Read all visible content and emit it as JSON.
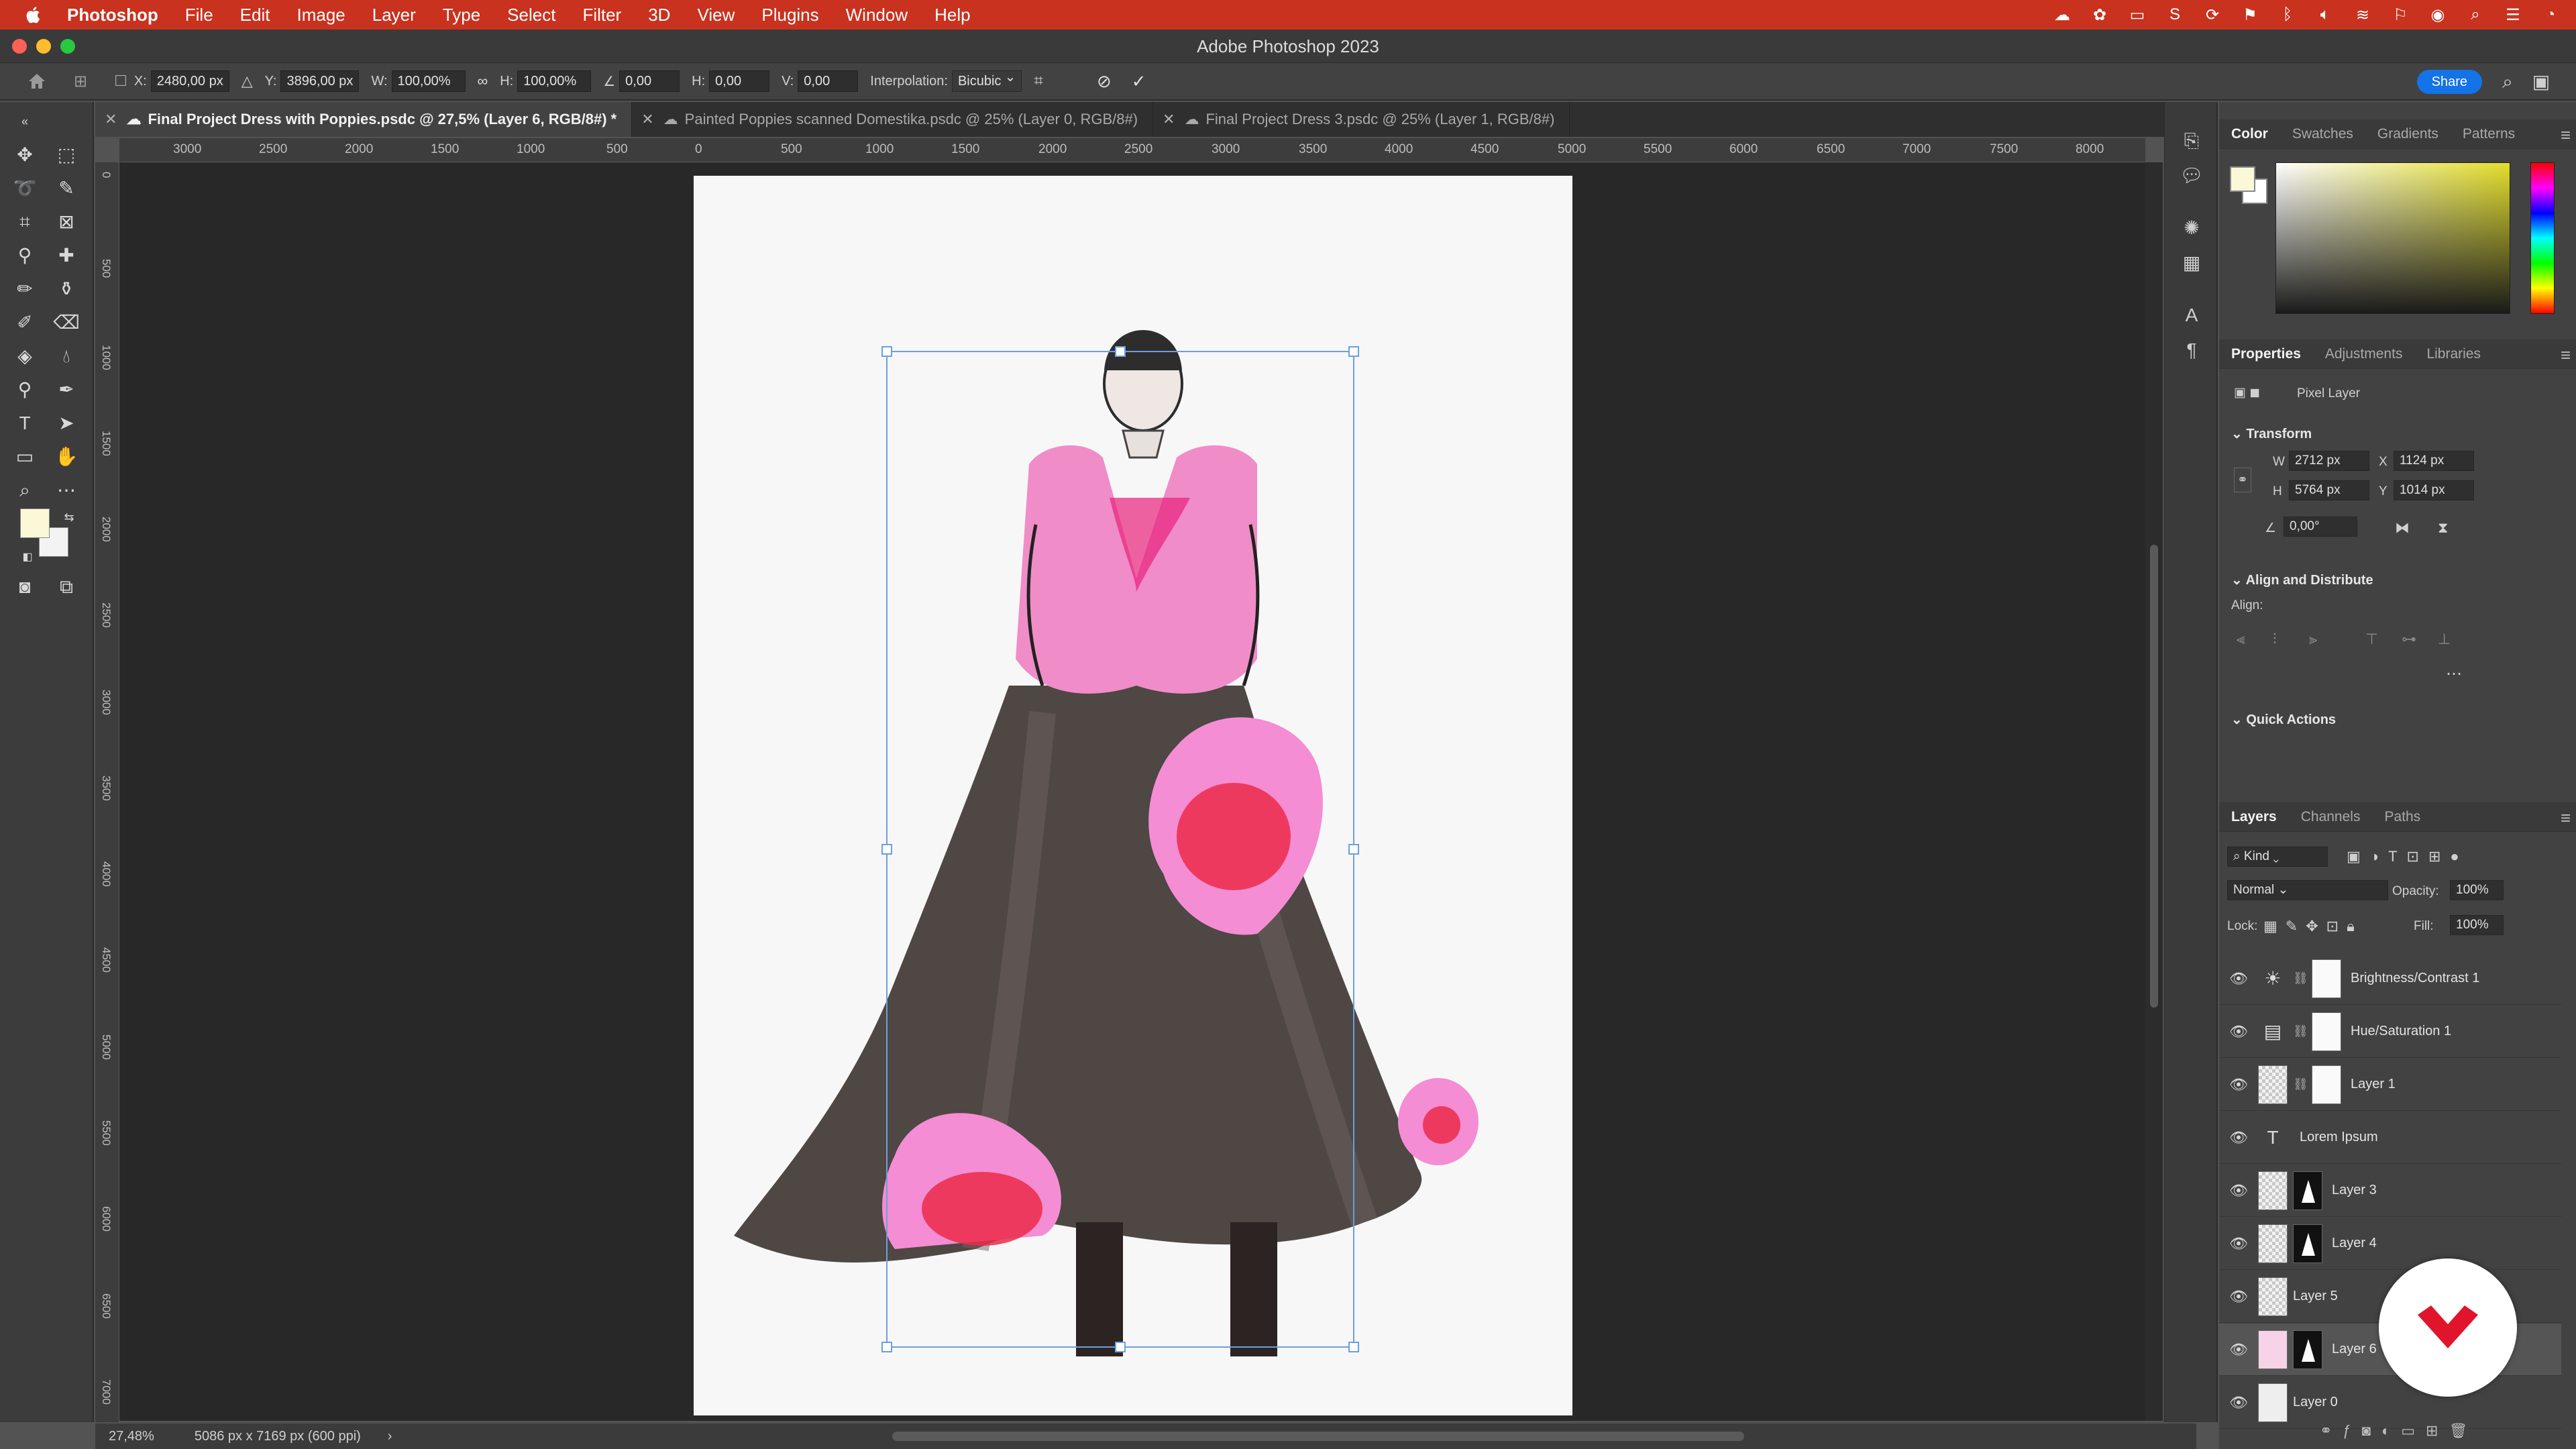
{
  "menubar": {
    "app": "Photoshop",
    "items": [
      "File",
      "Edit",
      "Image",
      "Layer",
      "Type",
      "Select",
      "Filter",
      "3D",
      "View",
      "Plugins",
      "Window",
      "Help"
    ]
  },
  "window": {
    "title": "Adobe Photoshop 2023"
  },
  "options": {
    "x_label": "X:",
    "x": "2480,00 px",
    "y_label": "Y:",
    "y": "3896,00 px",
    "w_label": "W:",
    "w": "100,00%",
    "h_label": "H:",
    "h": "100,00%",
    "angle": "0,00",
    "hskew_label": "H:",
    "hskew": "0,00",
    "vskew_label": "V:",
    "vskew": "0,00",
    "interp_label": "Interpolation:",
    "interp": "Bicubic",
    "share": "Share"
  },
  "tabs": [
    {
      "label": "Final Project Dress with Poppies.psdc @ 27,5% (Layer 6, RGB/8#) *",
      "active": true
    },
    {
      "label": "Painted Poppies scanned Domestika.psdc @ 25% (Layer 0, RGB/8#)",
      "active": false
    },
    {
      "label": "Final Project Dress 3.psdc @ 25% (Layer 1, RGB/8#)",
      "active": false
    }
  ],
  "ruler_h": [
    "3000",
    "2500",
    "2000",
    "1500",
    "1000",
    "500",
    "0",
    "500",
    "1000",
    "1500",
    "2000",
    "2500",
    "3000",
    "3500",
    "4000",
    "4500",
    "5000",
    "5500",
    "6000",
    "6500",
    "7000",
    "7500",
    "8000"
  ],
  "ruler_v": [
    "0",
    "500",
    "1000",
    "1500",
    "2000",
    "2500",
    "3000",
    "3500",
    "4000",
    "4500",
    "5000",
    "5500",
    "6000",
    "6500",
    "7000"
  ],
  "status": {
    "zoom": "27,48%",
    "docinfo": "5086 px x 7169 px (600 ppi)"
  },
  "color_panel": {
    "tabs": [
      "Color",
      "Swatches",
      "Gradients",
      "Patterns"
    ],
    "fg": "#fbf8d7"
  },
  "properties": {
    "tabs": [
      "Properties",
      "Adjustments",
      "Libraries"
    ],
    "kind": "Pixel Layer",
    "transform_title": "Transform",
    "w_label": "W",
    "w": "2712 px",
    "x_label": "X",
    "x": "1124 px",
    "h_label": "H",
    "h": "5764 px",
    "y_label": "Y",
    "y": "1014 px",
    "angle": "0,00°",
    "align_title": "Align and Distribute",
    "align_label": "Align:",
    "quick_title": "Quick Actions"
  },
  "layers_panel": {
    "tabs": [
      "Layers",
      "Channels",
      "Paths"
    ],
    "filter": "Kind",
    "blend": "Normal",
    "opacity_label": "Opacity:",
    "opacity": "100%",
    "lock_label": "Lock:",
    "fill_label": "Fill:",
    "fill": "100%",
    "layers": [
      {
        "name": "Brightness/Contrast 1",
        "type": "adjust-brightness"
      },
      {
        "name": "Hue/Saturation 1",
        "type": "adjust-hue"
      },
      {
        "name": "Layer 1",
        "type": "pixel-white"
      },
      {
        "name": "Lorem Ipsum",
        "type": "text"
      },
      {
        "name": "Layer 3",
        "type": "pixel-mask"
      },
      {
        "name": "Layer 4",
        "type": "pixel-mask"
      },
      {
        "name": "Layer 5",
        "type": "pixel"
      },
      {
        "name": "Layer 6",
        "type": "pixel-mask",
        "selected": true
      },
      {
        "name": "Layer 0",
        "type": "pixel-dress"
      }
    ]
  },
  "colors": {
    "menubar": "#c8321f",
    "accent": "#1473e6",
    "transform_box": "#6aa0e0",
    "poppy": "#ec2a4a"
  }
}
